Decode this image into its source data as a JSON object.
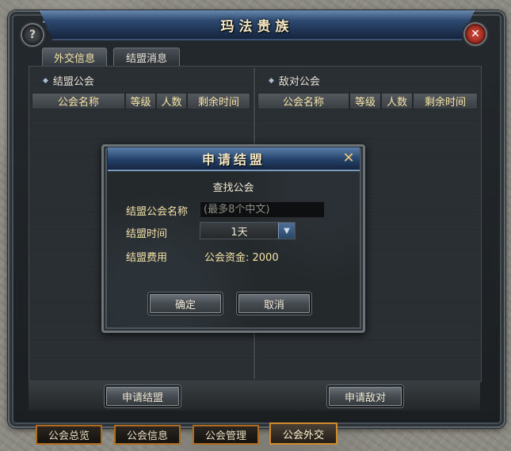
{
  "window": {
    "title": "玛法贵族"
  },
  "tabs": [
    {
      "label": "外交信息"
    },
    {
      "label": "结盟消息"
    }
  ],
  "allied_section": {
    "title": "结盟公会",
    "columns": [
      "公会名称",
      "等级",
      "人数",
      "剩余时间"
    ]
  },
  "enemy_section": {
    "title": "敌对公会",
    "columns": [
      "公会名称",
      "等级",
      "人数",
      "剩余时间"
    ]
  },
  "actions": {
    "apply_alliance": "申请结盟",
    "declare_enemy": "申请敌对"
  },
  "bottom_tabs": [
    {
      "label": "公会总览"
    },
    {
      "label": "公会信息"
    },
    {
      "label": "公会管理"
    },
    {
      "label": "公会外交"
    }
  ],
  "dialog": {
    "title": "申请结盟",
    "subtitle": "查找公会",
    "guild_name_label": "结盟公会名称",
    "guild_name_placeholder": "(最多8个中文)",
    "duration_label": "结盟时间",
    "duration_value": "1天",
    "fee_label": "结盟费用",
    "fee_value": "公会资金: 2000",
    "confirm": "确定",
    "cancel": "取消"
  },
  "icons": {
    "help": "question-mark-icon",
    "close": "close-x-icon",
    "dropdown": "chevron-down-icon"
  }
}
